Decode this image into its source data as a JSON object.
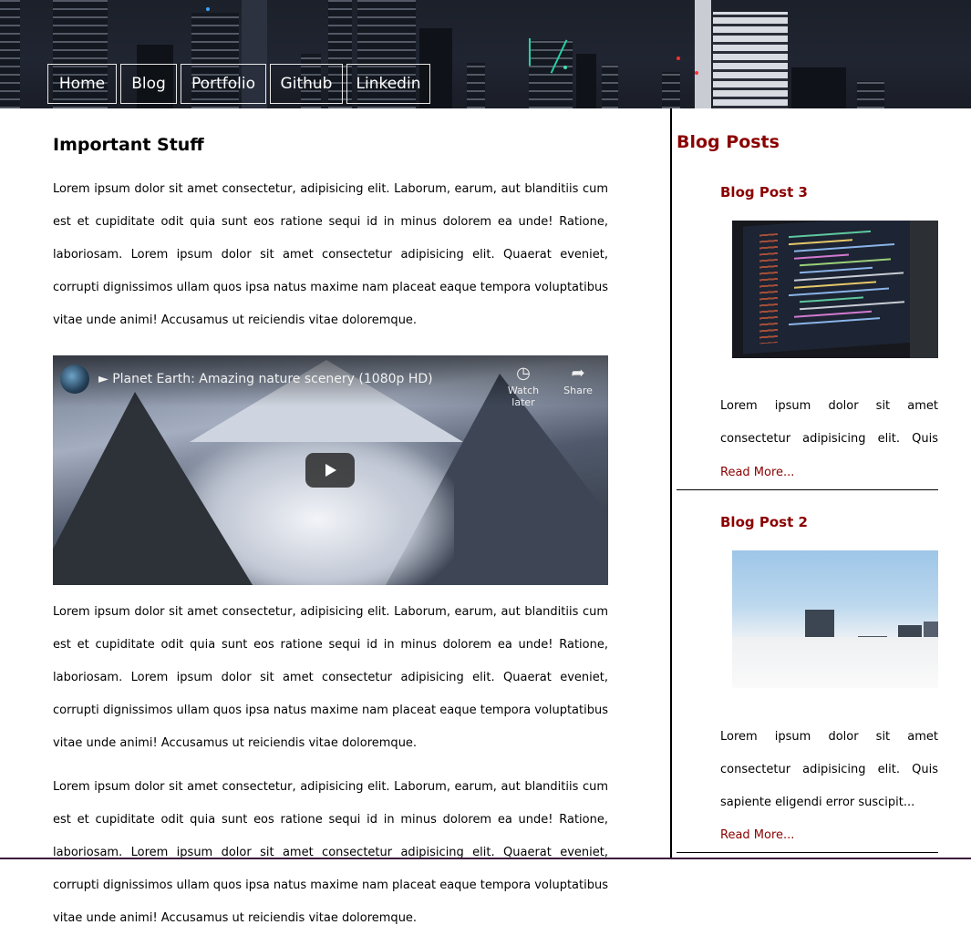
{
  "nav": {
    "items": [
      {
        "label": "Home"
      },
      {
        "label": "Blog"
      },
      {
        "label": "Portfolio"
      },
      {
        "label": "Github"
      },
      {
        "label": "Linkedin"
      }
    ]
  },
  "main": {
    "title": "Important Stuff",
    "paragraph": "Lorem ipsum dolor sit amet consectetur, adipisicing elit. Laborum, earum, aut blanditiis cum est et cupiditate odit quia sunt eos ratione sequi id in minus dolorem ea unde! Ratione, laboriosam. Lorem ipsum dolor sit amet consectetur adipisicing elit. Quaerat eveniet, corrupti dignissimos ullam quos ipsa natus maxime nam placeat eaque tempora voluptatibus vitae unde animi! Accusamus ut reiciendis vitae doloremque.",
    "video": {
      "title": "► Planet Earth: Amazing nature scenery (1080p HD)",
      "watch_later": "Watch later",
      "share": "Share",
      "watch_later_icon": "clock-icon",
      "share_icon": "share-arrow-icon"
    }
  },
  "sidebar": {
    "title": "Blog Posts",
    "posts": [
      {
        "title": "Blog Post 3",
        "excerpt": "Lorem ipsum dolor sit amet consectetur adipisicing elit. Quis sapiente eligendi,...",
        "read_more": "Read More..."
      },
      {
        "title": "Blog Post 2",
        "excerpt": "Lorem ipsum dolor sit amet consectetur adipisicing elit. Quis sapiente eligendi error suscipit...",
        "read_more": "Read More..."
      }
    ]
  },
  "colors": {
    "accent": "#8b0000",
    "text": "#000000",
    "background": "#ffffff"
  }
}
